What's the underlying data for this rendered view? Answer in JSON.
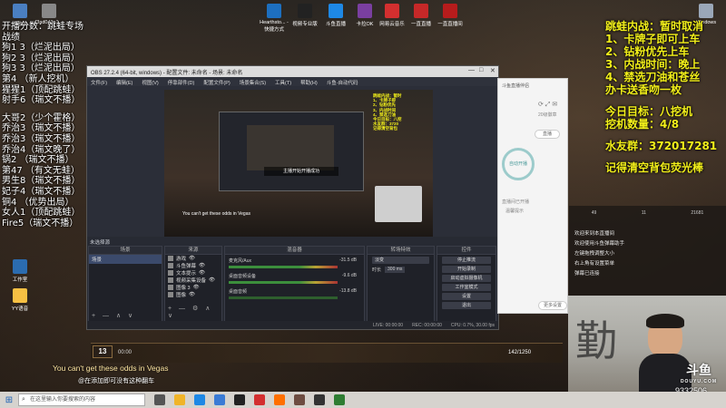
{
  "desktop": {
    "icons": [
      {
        "label": "此电脑",
        "color": "#4a7fc1"
      },
      {
        "label": "f3ad043e1...",
        "color": "#888888"
      },
      {
        "label": "Hearthsto... - 快捷方式",
        "color": "#1d6fbf"
      },
      {
        "label": "视频专业版",
        "color": "#222222"
      },
      {
        "label": "斗鱼直播",
        "color": "#1e88e5"
      },
      {
        "label": "卡拉OK",
        "color": "#7a3fa0"
      },
      {
        "label": "网易云音乐",
        "color": "#d32f2f"
      },
      {
        "label": "一直直播",
        "color": "#c62828"
      },
      {
        "label": "一直直播间",
        "color": "#b71c1c"
      },
      {
        "label": "工作室",
        "color": "#2b6cb0"
      },
      {
        "label": "YY语音",
        "color": "#f6c043"
      },
      {
        "label": "Windows",
        "color": "#9aa7b8"
      }
    ]
  },
  "overlay_left": {
    "lines": [
      "开播分数：跳蛙专场",
      "战绩",
      "狗1  3（烂泥出局）",
      "狗2  3（烂泥出局）",
      "狗3  3（烂泥出局）",
      "第4  （新人挖机）",
      "猩猩1（顶配跳蛙）",
      "射手6（瑞文不播）",
      "",
      "大哥2（少个霍格）",
      "乔治3（瑞文不播）",
      "乔治3（瑞文不播）",
      "乔治4（瑞文晚了）",
      "锅2  （瑞文不播）",
      "第47 （有文无蛙）",
      "男生8（瑞文不播）",
      "妃子4（瑞文不播）",
      "铜4  （优势出局）",
      "女人1（顶配跳蛙）",
      "Fire5（瑞文不播）"
    ]
  },
  "overlay_right": {
    "rules": [
      "跳蛙内战：暂时取消",
      "1、卡牌子即可上车",
      "2、钻粉优先上车",
      "3、内战时间：晚上",
      "4、禁选刀油和苍丝",
      "办卡送香吻一枚"
    ],
    "goal": "今日目标：八挖机",
    "progress": "挖机数量：4/8",
    "group": "水友群：372017281",
    "reminder": "记得清空背包荧光棒"
  },
  "obs": {
    "title": "OBS 27.2.4 (64-bit, windows) - 配置文件: 未命名 - 场景: 未命名",
    "menu": [
      "文件(F)",
      "编辑(E)",
      "视图(V)",
      "停靠部件(D)",
      "配置文件(P)",
      "场景集合(S)",
      "工具(T)",
      "帮助(H)",
      "斗鱼-自动代码"
    ],
    "toast": "主播开始开播成功",
    "preview_caption": "You can't get these odds in Vegas",
    "nested_overlay": [
      "跳蛙内战：暂时",
      "1、卡牌子即",
      "2、钻粉优先",
      "3、内战时间",
      "4、禁选刀油",
      "今日目标：八挖",
      "水友群：3720",
      "记得清空背包"
    ],
    "scene_dock_title": "场景",
    "scene_label": "未选择源",
    "scenes": [
      "场景"
    ],
    "sources_dock_title": "来源",
    "sources": [
      "游戏",
      "斗鱼弹幕",
      "文本提示",
      "视频采集设备",
      "图像 3",
      "图像"
    ],
    "mixer_title": "混音器",
    "mixer": [
      {
        "name": "麦克风/Aux",
        "value": "-31.5 dB"
      },
      {
        "name": "桌面音频设备",
        "value": "-9.6 dB"
      },
      {
        "name": "桌面音频",
        "value": "-13.8 dB"
      }
    ],
    "transitions_title": "转场特效",
    "transition_type": "淡变",
    "transition_duration_label": "时长",
    "transition_duration": "300 ms",
    "controls_title": "控件",
    "controls": [
      "停止推流",
      "开始录制",
      "启动虚拟摄像机",
      "工作室模式",
      "设置",
      "退出"
    ],
    "status": [
      "LIVE: 00:00:00",
      "REC: 00:00:00",
      "CPU: 0.7%, 30.00 fps"
    ]
  },
  "douyu_assistant": {
    "title": "斗鱼直播伴侣",
    "ring_label": "自动开播",
    "sub_label": "直播间已开播",
    "hint": "温馨提示",
    "button_left": "直播",
    "button_right": "更多设置",
    "level_label": "20级徽章"
  },
  "chat": {
    "stats": [
      "49",
      "11",
      "21681"
    ],
    "lines": [
      "欢迎来到本直播间",
      "欢迎使用斗鱼弹幕助手",
      "左键拖拽调整大小",
      "右上角有设置菜单",
      "弹幕已连接"
    ]
  },
  "webcam": {
    "calligraphy": "勤",
    "logo": "斗鱼",
    "logo_sub": "DOUYU.COM",
    "room_id": "9332506"
  },
  "game_hud": {
    "turn": "13",
    "clock": "00:00",
    "exp": "142/1250",
    "caption": "You can't get these odds in Vegas",
    "subcaption": "@在添加即可没有这种翻车"
  },
  "taskbar": {
    "search_placeholder": "在这里输入你要搜索的内容",
    "apps": [
      {
        "name": "task-view",
        "color": "#555555"
      },
      {
        "name": "file-explorer",
        "color": "#f0b429"
      },
      {
        "name": "edge",
        "color": "#1e88e5"
      },
      {
        "name": "store",
        "color": "#3a7bd5"
      },
      {
        "name": "obs",
        "color": "#222222"
      },
      {
        "name": "netease-music",
        "color": "#d32f2f"
      },
      {
        "name": "douyu",
        "color": "#ff6f00"
      },
      {
        "name": "hearthstone",
        "color": "#6d4c41"
      },
      {
        "name": "terminal",
        "color": "#333333"
      },
      {
        "name": "screenshot",
        "color": "#2e7d32"
      }
    ]
  }
}
